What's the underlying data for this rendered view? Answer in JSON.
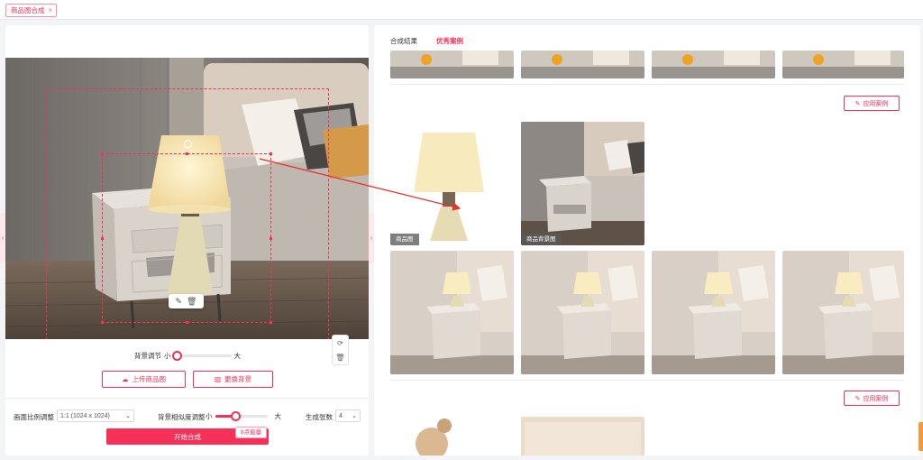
{
  "tab": {
    "label": "商品图合成",
    "close": "×"
  },
  "editor": {
    "slider_label": "背景调节",
    "slider_min": "小",
    "slider_max": "大",
    "slider_value": 0.05,
    "upload_button": "上传商品图",
    "change_bg_button": "更换背景"
  },
  "options": {
    "ratio_label": "画面比例调整",
    "ratio_value": "1:1 (1024 x 1024)",
    "similarity_label": "背景相似度调整",
    "similarity_min": "小",
    "similarity_max": "大",
    "similarity_value": 0.38,
    "count_label": "生成张数",
    "count_value": "4",
    "start_button": "开始合成",
    "cost_tag": "8点能量"
  },
  "results": {
    "tabs": [
      "合成结果",
      "优秀案例"
    ],
    "active_tab": 1,
    "apply_button": "应用案例",
    "product_caption": "商品图",
    "background_caption": "商品背景图"
  },
  "colors": {
    "accent": "#f5315a"
  }
}
